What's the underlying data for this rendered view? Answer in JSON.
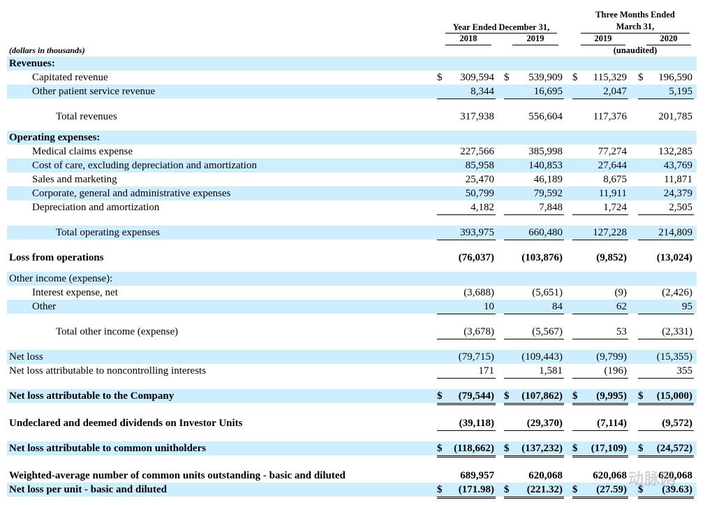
{
  "header": {
    "year_group": "Year Ended December 31,",
    "quarter_group_line1": "Three Months Ended",
    "quarter_group_line2": "March 31,",
    "unaudited": "(unaudited)",
    "columns": [
      "2018",
      "2019",
      "2019",
      "2020"
    ],
    "units_note": "(dollars in thousands)"
  },
  "rows": [
    {
      "label": "Revenues:",
      "bold": true,
      "shade": true,
      "indent": 0,
      "values": []
    },
    {
      "label": "Capitated revenue",
      "indent": 1,
      "values": [
        "309,594",
        "539,909",
        "115,329",
        "196,590"
      ],
      "dollar": [
        true,
        true,
        true,
        true
      ]
    },
    {
      "label": "Other patient service revenue",
      "indent": 1,
      "shade": true,
      "values": [
        "8,344",
        "16,695",
        "2,047",
        "5,195"
      ],
      "underline": "single"
    },
    {
      "label": "Total revenues",
      "indent": 2,
      "values": [
        "317,938",
        "556,604",
        "117,376",
        "201,785"
      ]
    },
    {
      "label": "Operating expenses:",
      "bold": true,
      "shade": true,
      "indent": 0,
      "values": []
    },
    {
      "label": "Medical claims expense",
      "indent": 1,
      "values": [
        "227,566",
        "385,998",
        "77,274",
        "132,285"
      ]
    },
    {
      "label": "Cost of care, excluding depreciation and amortization",
      "indent": 1,
      "shade": true,
      "values": [
        "85,958",
        "140,853",
        "27,644",
        "43,769"
      ]
    },
    {
      "label": "Sales and marketing",
      "indent": 1,
      "values": [
        "25,470",
        "46,189",
        "8,675",
        "11,871"
      ]
    },
    {
      "label": "Corporate, general and administrative expenses",
      "indent": 1,
      "shade": true,
      "values": [
        "50,799",
        "79,592",
        "11,911",
        "24,379"
      ]
    },
    {
      "label": "Depreciation and amortization",
      "indent": 1,
      "values": [
        "4,182",
        "7,848",
        "1,724",
        "2,505"
      ],
      "underline": "single"
    },
    {
      "label": "Total operating expenses",
      "indent": 2,
      "shade": true,
      "values": [
        "393,975",
        "660,480",
        "127,228",
        "214,809"
      ],
      "underline": "single"
    },
    {
      "label": "Loss from operations",
      "bold": true,
      "indent": 0,
      "values": [
        "(76,037)",
        "(103,876)",
        "(9,852)",
        "(13,024)"
      ]
    },
    {
      "label": "Other income (expense):",
      "indent": 0,
      "shade": true,
      "values": []
    },
    {
      "label": "Interest expense, net",
      "indent": 1,
      "values": [
        "(3,688)",
        "(5,651)",
        "(9)",
        "(2,426)"
      ]
    },
    {
      "label": "Other",
      "indent": 1,
      "shade": true,
      "values": [
        "10",
        "84",
        "62",
        "95"
      ],
      "underline": "single"
    },
    {
      "label": "Total other income (expense)",
      "indent": 2,
      "values": [
        "(3,678)",
        "(5,567)",
        "53",
        "(2,331)"
      ],
      "underline": "single"
    },
    {
      "label": "Net loss",
      "indent": 0,
      "shade": true,
      "values": [
        "(79,715)",
        "(109,443)",
        "(9,799)",
        "(15,355)"
      ]
    },
    {
      "label": "Net loss attributable to noncontrolling interests",
      "indent": 0,
      "values": [
        "171",
        "1,581",
        "(196)",
        "355"
      ],
      "underline": "single"
    },
    {
      "label": "Net loss attributable to the Company",
      "bold": true,
      "indent": 0,
      "shade": true,
      "values": [
        "(79,544)",
        "(107,862)",
        "(9,995)",
        "(15,000)"
      ],
      "dollar": [
        true,
        true,
        true,
        true
      ],
      "underline": "double"
    },
    {
      "label": "Undeclared and deemed dividends on Investor Units",
      "bold": true,
      "indent": 0,
      "values": [
        "(39,118)",
        "(29,370)",
        "(7,114)",
        "(9,572)"
      ],
      "underline": "single"
    },
    {
      "label": "Net loss attributable to common unitholders",
      "bold": true,
      "indent": 0,
      "shade": true,
      "values": [
        "(118,662)",
        "(137,232)",
        "(17,109)",
        "(24,572)"
      ],
      "dollar": [
        true,
        true,
        true,
        true
      ],
      "underline": "double"
    },
    {
      "label": "Weighted-average number of common units outstanding - basic and diluted",
      "bold": true,
      "indent": 0,
      "values": [
        "689,957",
        "620,068",
        "620,068",
        "620,068"
      ]
    },
    {
      "label": "Net loss per unit - basic and diluted",
      "bold": true,
      "indent": 0,
      "shade": true,
      "values": [
        "(171.98)",
        "(221.32)",
        "(27.59)",
        "(39.63)"
      ],
      "dollar": [
        true,
        true,
        true,
        true
      ],
      "underline": "double"
    }
  ],
  "dollar_sign": "$",
  "watermark": "动脉网"
}
